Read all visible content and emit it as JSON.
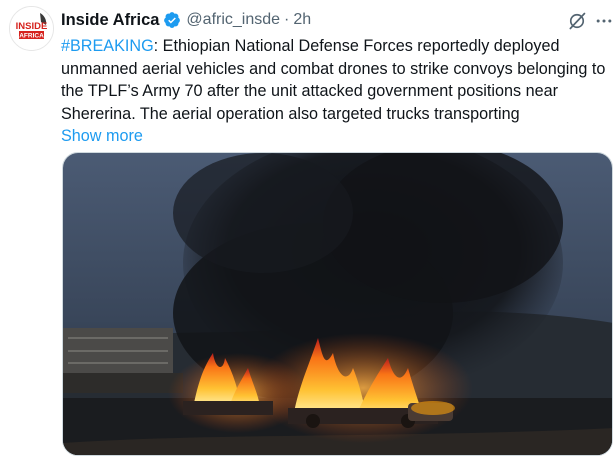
{
  "account": {
    "display_name": "Inside Africa",
    "handle": "@afric_insde",
    "separator": "·",
    "time": "2h",
    "avatar_text_top": "INSIDE",
    "avatar_text_bottom": "AFRICA"
  },
  "tweet": {
    "hashtag": "#BREAKING",
    "body": ": Ethiopian National Defense Forces reportedly deployed unmanned aerial vehicles and combat drones to strike convoys belonging to the TPLF’s Army 70 after the unit attacked government positions near Shererina. The aerial operation also targeted trucks transporting",
    "show_more": "Show more"
  },
  "icons": {
    "verified": "verified-badge-icon",
    "grok": "grok-icon",
    "more": "more-options-icon"
  },
  "colors": {
    "accent": "#1d9bf0",
    "text": "#0f1419",
    "secondary": "#536471",
    "avatar_red": "#d6231e"
  }
}
